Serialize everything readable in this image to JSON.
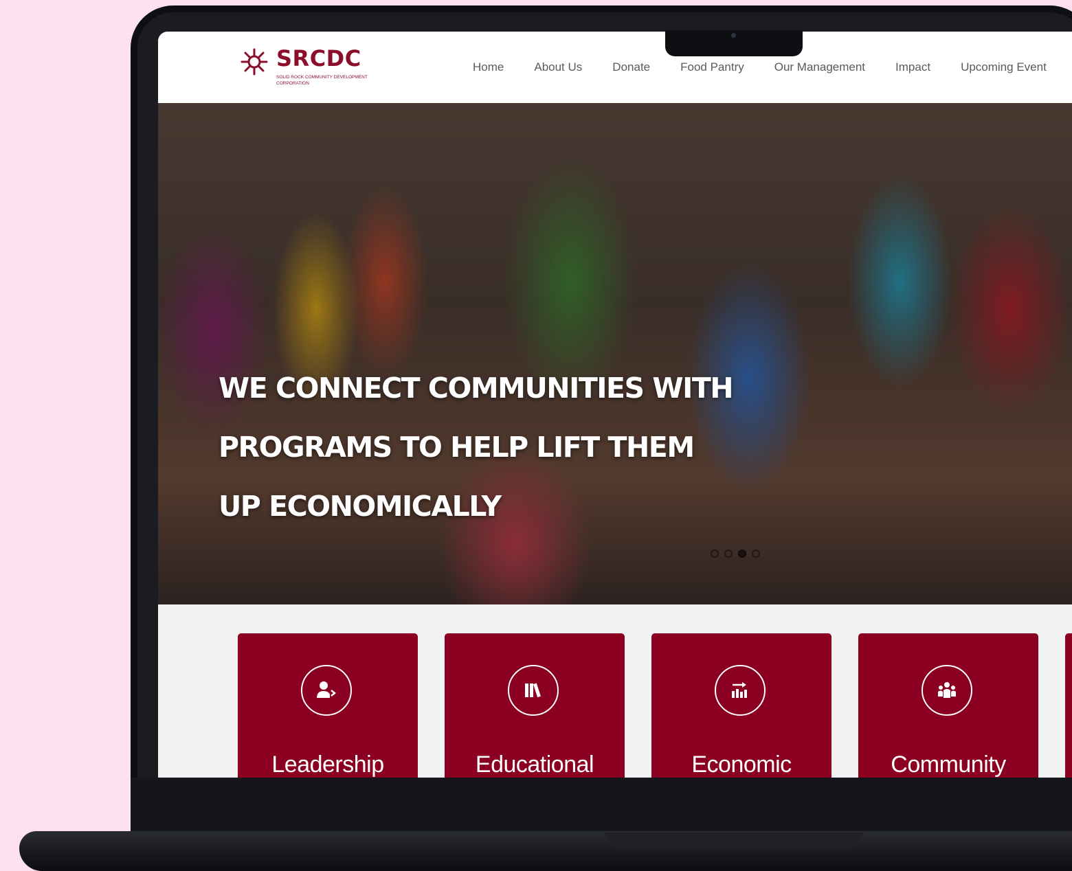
{
  "brand": {
    "name": "SRCDC",
    "tagline": "Solid Rock Community Development Corporation",
    "color": "#8b0f2a"
  },
  "nav": {
    "items": [
      "Home",
      "About Us",
      "Donate",
      "Food Pantry",
      "Our Management",
      "Impact",
      "Upcoming Event"
    ]
  },
  "hero": {
    "headline": "WE CONNECT COMMUNITIES WITH PROGRAMS TO HELP LIFT THEM UP ECONOMICALLY",
    "line1": "WE CONNECT COMMUNITIES WITH",
    "line2": "PROGRAMS TO HELP LIFT THEM",
    "line3": "UP ECONOMICALLY",
    "slides": 4,
    "active_slide": 3
  },
  "programs": [
    {
      "label": "Leadership",
      "icon": "leadership-icon"
    },
    {
      "label": "Educational",
      "icon": "books-icon"
    },
    {
      "label": "Economic",
      "icon": "growth-chart-icon"
    },
    {
      "label": "Community",
      "icon": "people-icon"
    }
  ],
  "colors": {
    "card": "#8b0020",
    "background": "#fde1f1"
  }
}
